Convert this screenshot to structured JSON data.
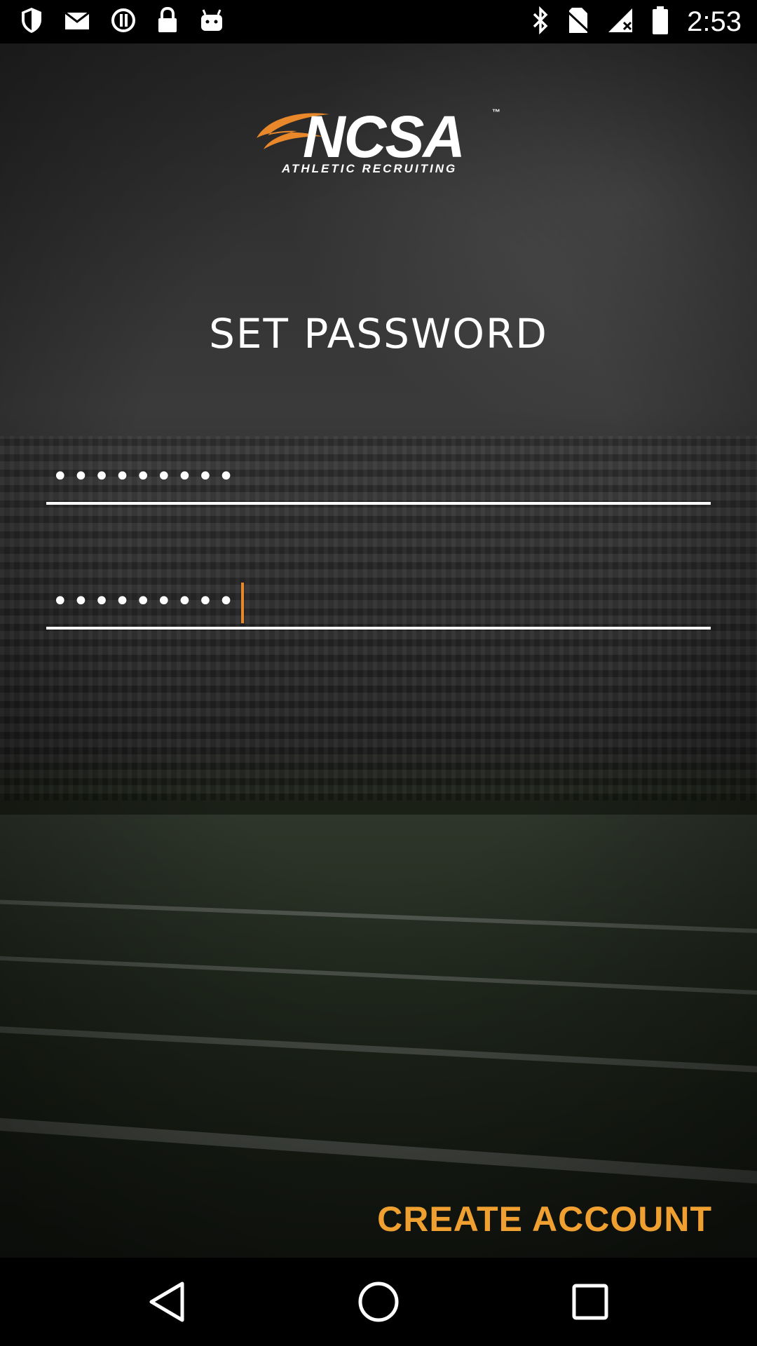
{
  "status_bar": {
    "time": "2:53",
    "left_icons": [
      "shield-icon",
      "mail-icon",
      "info-icon",
      "lock-icon",
      "android-icon"
    ],
    "right_icons": [
      "bluetooth-icon",
      "no-sim-icon",
      "signal-icon",
      "battery-icon"
    ]
  },
  "logo": {
    "main_text": "NCSA",
    "trademark": "™",
    "sub_text": "ATHLETIC RECRUITING",
    "accent_color": "#e8882a"
  },
  "page": {
    "title": "SET PASSWORD"
  },
  "form": {
    "password": {
      "value": "•••••••••"
    },
    "confirm_password": {
      "value": "•••••••••"
    }
  },
  "actions": {
    "create_account_label": "CREATE ACCOUNT",
    "color": "#f0a030"
  },
  "nav_bar": {
    "buttons": [
      "back-icon",
      "home-icon",
      "recents-icon"
    ]
  }
}
